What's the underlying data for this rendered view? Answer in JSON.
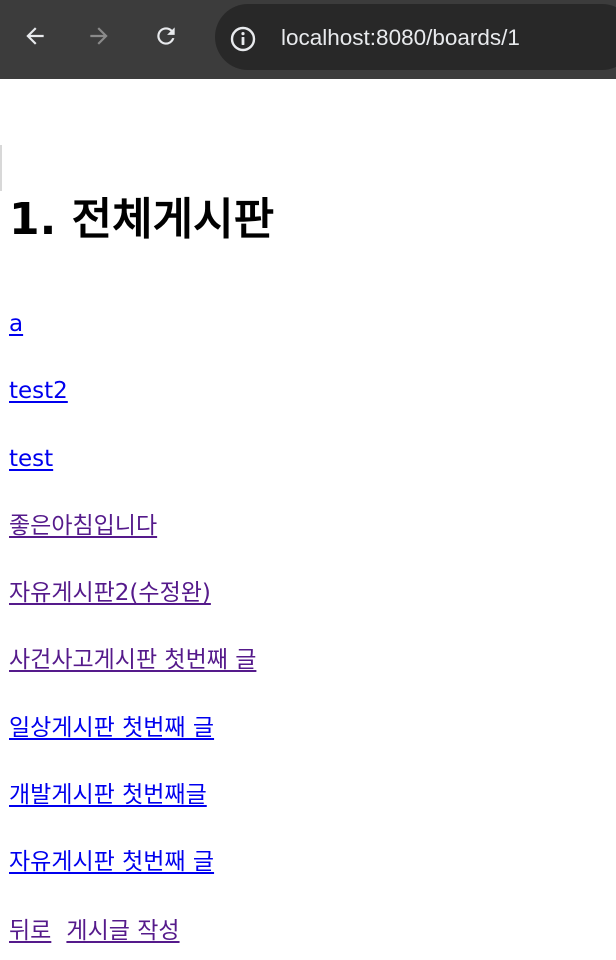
{
  "browser": {
    "url": "localhost:8080/boards/1",
    "icons": {
      "back": "arrow-left-icon",
      "forward": "arrow-right-icon",
      "reload": "reload-icon",
      "site_info": "info-circle-icon"
    },
    "colors": {
      "toolbar": "#3c3c3c",
      "omnibox": "#282828",
      "text": "#e8eaed",
      "disabled": "#8a8a8a"
    }
  },
  "page": {
    "title": "1. 전체게시판",
    "posts": [
      {
        "title": "a"
      },
      {
        "title": "test2"
      },
      {
        "title": "test"
      },
      {
        "title": "좋은아침입니다"
      },
      {
        "title": "자유게시판2(수정완)"
      },
      {
        "title": "사건사고게시판 첫번째 글"
      },
      {
        "title": "일상게시판 첫번째 글"
      },
      {
        "title": "개발게시판 첫번째글"
      },
      {
        "title": "자유게시판 첫번째 글"
      }
    ],
    "footer": {
      "back_label": "뒤로",
      "write_label": "게시글 작성"
    },
    "colors": {
      "link": "#0000ee",
      "visited_link": "#551a8b"
    }
  }
}
